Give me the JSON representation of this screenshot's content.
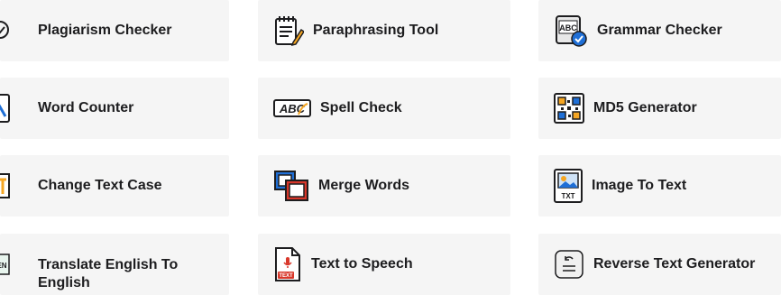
{
  "tools": [
    {
      "label": "Plagiarism Checker",
      "icon": "magnifier-icon"
    },
    {
      "label": "Paraphrasing Tool",
      "icon": "notepad-pencil-icon"
    },
    {
      "label": "Grammar Checker",
      "icon": "abc-check-icon"
    },
    {
      "label": "Word Counter",
      "icon": "document-icon"
    },
    {
      "label": "Spell Check",
      "icon": "abc-spell-icon"
    },
    {
      "label": "MD5 Generator",
      "icon": "qr-code-icon"
    },
    {
      "label": "Change Text Case",
      "icon": "text-case-icon"
    },
    {
      "label": "Merge Words",
      "icon": "merge-squares-icon"
    },
    {
      "label": "Image To Text",
      "icon": "image-txt-icon"
    },
    {
      "label": "Translate English To English",
      "icon": "translate-icon"
    },
    {
      "label": "Text to Speech",
      "icon": "microphone-file-icon"
    },
    {
      "label": "Reverse Text Generator",
      "icon": "reverse-text-icon"
    }
  ],
  "colors": {
    "card_bg": "#f5f5f5",
    "text": "#1d1d1f",
    "accent_orange": "#f5a623",
    "accent_blue": "#1f6fd6",
    "accent_red": "#d8372a"
  }
}
